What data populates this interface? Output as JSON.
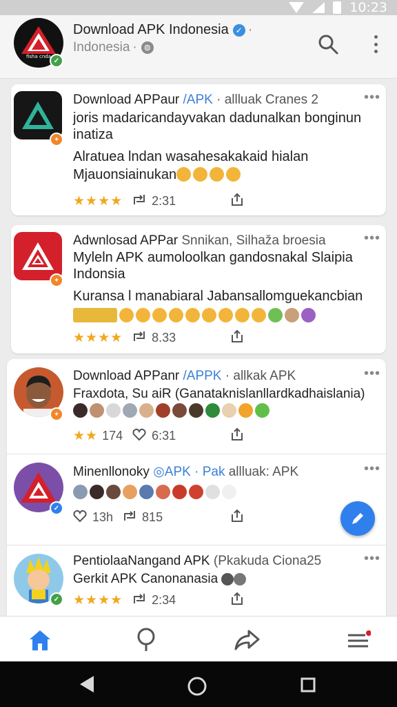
{
  "status_bar": {
    "time": "10:23"
  },
  "header": {
    "avatar_text": "fisha cnda",
    "title": "Download APK Indonesia",
    "subtitle": "Indonesia"
  },
  "posts": [
    {
      "title": "Download APPaur",
      "handle": "/APK",
      "meta": "· allluak Cranes 2",
      "lines": [
        "joris madaricandayvakan dadunalkan bonginun",
        "inatiza",
        "Alratuea lndan wasahesakakaid hialan",
        "Mjauonsiainukan"
      ],
      "rating": "★★★★",
      "count": "2:31",
      "avatar": "black-triangle-app-icon"
    },
    {
      "title": "Adwnlosad APPar",
      "handle": "Snnikan, Silhaža broesia",
      "meta": "",
      "lines": [
        "Myleln APK aumoloolkan  gandosnakal Slaipia",
        "Indonsia",
        "Kuransa l manabiaral Jabansallomguekancbian"
      ],
      "rating": "★★★★",
      "count": "8.33",
      "avatar": "red-triangle-app-icon"
    },
    {
      "title": "Download APPanr",
      "handle": "/APPK",
      "meta": "· allkak APK",
      "lines": [
        "Fraxdota, Su aiR (Ganataknislanllardkadhaislania)"
      ],
      "rating": "★★",
      "rating_count": "174",
      "count": "6:31",
      "avatar": "man-avatar"
    },
    {
      "title": "Minenllonoky",
      "handle": "APK",
      "handle2": "· Pak",
      "meta": "allluak: APK",
      "lines": [],
      "likes": "13h",
      "count": "815",
      "avatar": "purple-triangle-avatar"
    },
    {
      "title": "PentiolaaNangand APK",
      "handle": "(Pkakuda Ciona25",
      "meta": "",
      "lines": [
        "Gerkit APK Canonanasia"
      ],
      "rating": "★★★★",
      "count": "2:34",
      "avatar": "cartoon-avatar"
    }
  ],
  "colors": {
    "accent": "#2f80ed",
    "star": "#f0a81e",
    "red_icon": "#d3202a",
    "nav_bar": "#080808"
  },
  "nav": [
    "home-icon",
    "search-icon",
    "share-icon",
    "menu-icon"
  ]
}
